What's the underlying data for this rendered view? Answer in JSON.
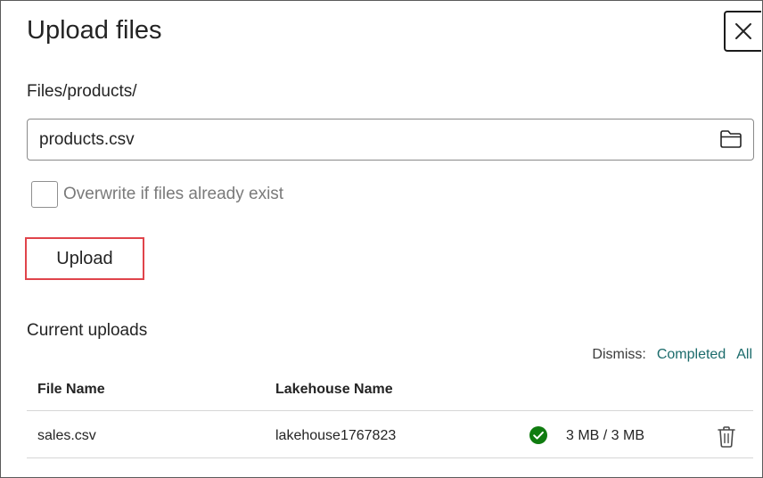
{
  "dialog": {
    "title": "Upload files"
  },
  "path": {
    "label": "Files/products/"
  },
  "file_input": {
    "value": "products.csv",
    "icon": "folder-icon"
  },
  "overwrite": {
    "label": "Overwrite if files already exist",
    "checked": false
  },
  "upload_button": {
    "label": "Upload"
  },
  "current_uploads": {
    "title": "Current uploads",
    "dismiss_label": "Dismiss:",
    "dismiss_completed": "Completed",
    "dismiss_all": "All",
    "columns": [
      "File Name",
      "Lakehouse Name"
    ],
    "rows": [
      {
        "file_name": "sales.csv",
        "lakehouse_name": "lakehouse1767823",
        "status_icon": "check-circle-icon",
        "progress": "3 MB / 3 MB"
      }
    ]
  },
  "colors": {
    "highlight_border": "#e0444b",
    "link": "#1b6b6b",
    "success": "#107c10"
  }
}
